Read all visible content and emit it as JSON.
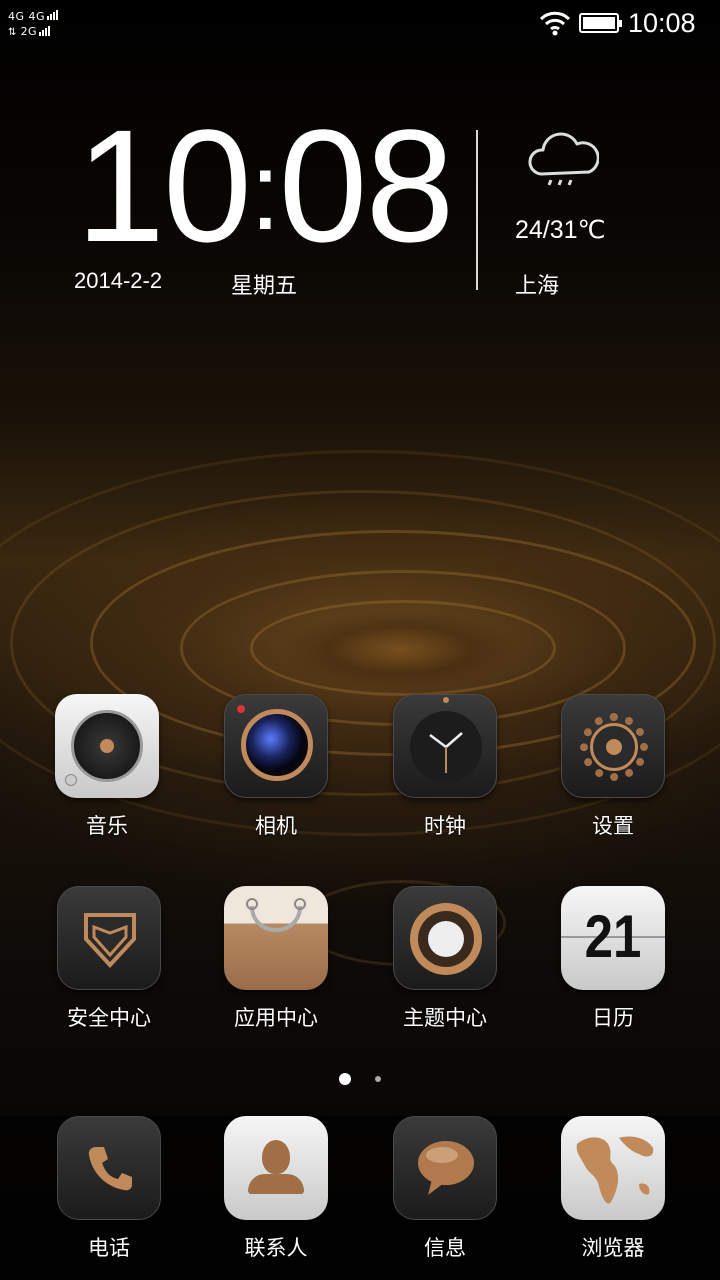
{
  "status_bar": {
    "signal_line1": "4G 4G",
    "signal_line2": "2G",
    "time": "10:08",
    "wifi_icon": "wifi-icon",
    "battery_icon": "battery-icon"
  },
  "clock_widget": {
    "time_hours": "10",
    "time_minutes": "08",
    "date": "2014-2-2",
    "weekday": "星期五",
    "weather_icon": "rain-cloud-icon",
    "temperature": "24/31℃",
    "city": "上海"
  },
  "apps_row1": [
    {
      "label": "音乐",
      "icon": "music-icon"
    },
    {
      "label": "相机",
      "icon": "camera-icon"
    },
    {
      "label": "时钟",
      "icon": "clock-icon"
    },
    {
      "label": "设置",
      "icon": "settings-gear-icon"
    }
  ],
  "apps_row2": [
    {
      "label": "安全中心",
      "icon": "shield-icon"
    },
    {
      "label": "应用中心",
      "icon": "shopping-bag-icon"
    },
    {
      "label": "主题中心",
      "icon": "theme-icon"
    },
    {
      "label": "日历",
      "icon": "calendar-icon",
      "day": "21"
    }
  ],
  "page_indicator": {
    "pages": 2,
    "current": 1
  },
  "dock": [
    {
      "label": "电话",
      "icon": "phone-icon"
    },
    {
      "label": "联系人",
      "icon": "contacts-icon"
    },
    {
      "label": "信息",
      "icon": "message-icon"
    },
    {
      "label": "浏览器",
      "icon": "globe-map-icon"
    }
  ],
  "colors": {
    "accent_copper": "#c08a5a",
    "icon_dark": "#2a2a2a"
  }
}
